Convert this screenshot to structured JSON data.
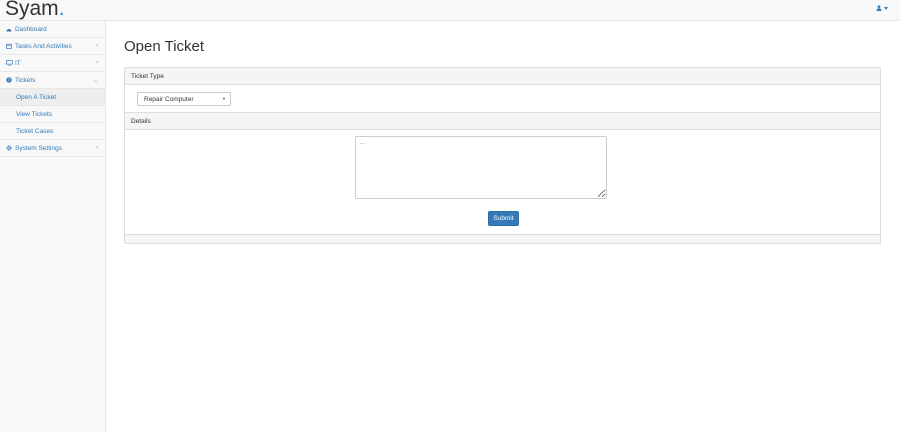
{
  "brand": {
    "name": "Syam",
    "dot": "."
  },
  "user_menu": {
    "icon": "user-icon",
    "caret": "caret-down-icon"
  },
  "sidebar": {
    "items": [
      {
        "label": "Dashboard",
        "icon": "dashboard-icon",
        "chevron": ""
      },
      {
        "label": "Tasks And Activities",
        "icon": "calendar-icon",
        "chevron": "‹"
      },
      {
        "label": "IT",
        "icon": "monitor-icon",
        "chevron": "‹"
      },
      {
        "label": "Tickets",
        "icon": "question-circle-icon",
        "chevron": "⌄"
      },
      {
        "label": "System Settings",
        "icon": "gear-icon",
        "chevron": "‹"
      }
    ],
    "tickets_sub": [
      {
        "label": "Open A Ticket",
        "active": true
      },
      {
        "label": "View Tickets",
        "active": false
      },
      {
        "label": "Ticket Cases",
        "active": false
      }
    ]
  },
  "main": {
    "title": "Open Ticket",
    "ticket_type_heading": "Ticket Type",
    "ticket_type_selected": "Repair Computer",
    "details_heading": "Details",
    "details_placeholder": "...",
    "submit_label": "Submit"
  },
  "colors": {
    "link": "#337ab7",
    "brand_dot": "#1d8fe1",
    "button": "#337ab7"
  }
}
